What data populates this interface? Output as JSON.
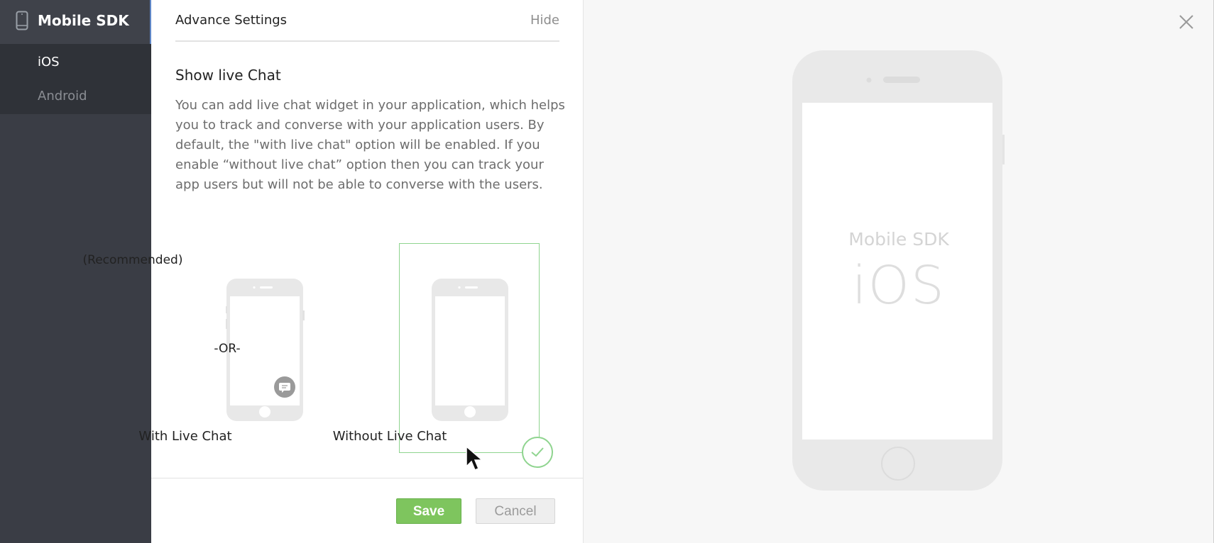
{
  "sidebar": {
    "title": "Mobile SDK",
    "items": [
      {
        "label": "iOS",
        "active": true
      },
      {
        "label": "Android",
        "active": false
      }
    ],
    "icon": "phone-icon"
  },
  "panel": {
    "title": "Advance Settings",
    "hide_label": "Hide",
    "section_title": "Show live Chat",
    "description": "You can add live chat widget in your application, which helps you to track and converse with your application users. By default, the \"with live chat\" option will be enabled. If you enable “without live chat” option then you can track your app users but will not be able to converse with the users.",
    "recommended_label": "(Recommended)",
    "or_label": "-OR-",
    "options": [
      {
        "label": "With Live Chat",
        "selected": false
      },
      {
        "label": "Without Live Chat",
        "selected": true
      }
    ],
    "save_label": "Save",
    "cancel_label": "Cancel"
  },
  "preview": {
    "line1": "Mobile SDK",
    "line2": "iOS",
    "close_icon": "close-icon"
  },
  "colors": {
    "sidebar_bg": "#3a3d45",
    "accent_green": "#7ec55e",
    "selection_border": "#8fd48f"
  }
}
